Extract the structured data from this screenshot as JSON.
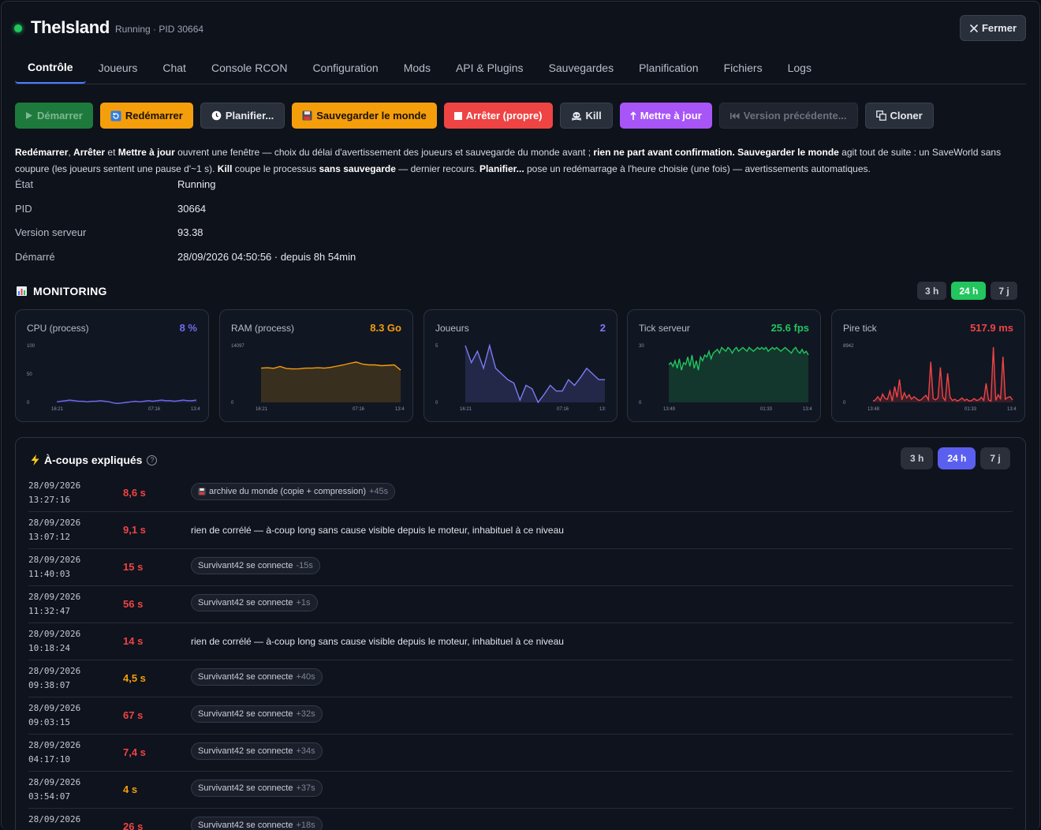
{
  "header": {
    "title": "TheIsland",
    "subtitle": "Running · PID 30664",
    "close_label": "Fermer"
  },
  "tabs": [
    "Contrôle",
    "Joueurs",
    "Chat",
    "Console RCON",
    "Configuration",
    "Mods",
    "API & Plugins",
    "Sauvegardes",
    "Planification",
    "Fichiers",
    "Logs"
  ],
  "actions": {
    "start": "Démarrer",
    "restart": "Redémarrer",
    "schedule": "Planifier...",
    "save": "Sauvegarder le monde",
    "stop": "Arrêter (propre)",
    "kill": "Kill",
    "update": "Mettre à jour",
    "rollback": "Version précédente...",
    "clone": "Cloner"
  },
  "note": {
    "p1": "Redémarrer",
    "p2": ", ",
    "p3": "Arrêter",
    "p4": " et ",
    "p5": "Mettre à jour",
    "p6": " ouvrent une fenêtre — choix du délai d'avertissement des joueurs et sauvegarde du monde avant ; ",
    "p7": "rien ne part avant confirmation.",
    "p8": " ",
    "p9": "Sauvegarder le monde",
    "p10": " agit tout de suite : un SaveWorld sans coupure (les joueurs sentent une pause d'~1 s). ",
    "p11": "Kill",
    "p12": " coupe le processus ",
    "p13": "sans sauvegarde",
    "p14": " — dernier recours. ",
    "p15": "Planifier...",
    "p16": " pose un redémarrage à l'heure choisie (une fois) — avertissements automatiques."
  },
  "info": [
    {
      "label": "État",
      "value": "Running"
    },
    {
      "label": "PID",
      "value": "30664"
    },
    {
      "label": "Version serveur",
      "value": "93.38"
    },
    {
      "label": "Démarré",
      "value": "28/09/2026 04:50:56 · depuis 8h 54min"
    }
  ],
  "monitoring": {
    "title": "MONITORING",
    "icon": "bar-chart-icon",
    "ranges": [
      "3 h",
      "24 h",
      "7 j"
    ],
    "active_range": "24 h"
  },
  "colors": {
    "cpu": "#6f6cf0",
    "ram": "#f59e0b",
    "players": "#7b7cf5",
    "tick": "#22c55e",
    "worst": "#ef4444",
    "accent_blue": "#4c7dff"
  },
  "chart_data": [
    {
      "type": "area",
      "title": "CPU (process)",
      "value": "8 %",
      "yticks": [
        "100",
        "50",
        "0"
      ],
      "xticks": [
        "16:21",
        "07:16",
        "13:4"
      ],
      "ylim": [
        0,
        100
      ],
      "values": [
        1,
        2,
        3,
        4,
        3,
        2,
        2,
        1,
        2,
        2,
        3,
        2,
        1,
        -1,
        -2,
        -1,
        0,
        1,
        2,
        1,
        2,
        3,
        2,
        3,
        4,
        3,
        3,
        2,
        3,
        4,
        3,
        3,
        4
      ]
    },
    {
      "type": "area",
      "title": "RAM (process)",
      "value": "8.3 Go",
      "yticks": [
        "14097",
        "0"
      ],
      "xticks": [
        "16:21",
        "07:16",
        "13:4"
      ],
      "ylim": [
        0,
        14097
      ],
      "values": [
        8500,
        8600,
        8450,
        8900,
        8400,
        8300,
        8350,
        8500,
        8500,
        8600,
        8500,
        8700,
        9000,
        9300,
        9700,
        10000,
        9500,
        9300,
        9300,
        9100,
        9200,
        9300,
        8000
      ]
    },
    {
      "type": "area",
      "title": "Joueurs",
      "value": "2",
      "yticks": [
        "5",
        "0"
      ],
      "xticks": [
        "16:21",
        "07:16",
        "13:"
      ],
      "ylim": [
        0,
        5
      ],
      "values": [
        5,
        3.5,
        4.5,
        3,
        5,
        3,
        2.5,
        2,
        1.7,
        0.2,
        1.5,
        1.2,
        0,
        0.7,
        1.5,
        1,
        1,
        2,
        1.5,
        2.2,
        3,
        2.5,
        2,
        2
      ]
    },
    {
      "type": "area",
      "title": "Tick serveur",
      "value": "25.6 fps",
      "yticks": [
        "30",
        "0"
      ],
      "xticks": [
        "13:49",
        "01:33",
        "13:4"
      ],
      "ylim": [
        0,
        30
      ],
      "values": [
        20,
        21,
        19,
        22,
        18,
        23,
        17,
        21,
        20,
        24,
        19,
        25,
        18,
        22,
        17,
        24,
        22,
        25,
        24,
        27,
        23,
        26,
        27,
        28,
        26,
        29,
        28,
        27,
        29,
        28,
        26,
        28,
        29,
        27,
        28,
        29,
        28,
        27,
        29,
        28,
        27,
        28,
        29,
        28,
        29,
        28,
        29,
        27,
        28,
        29,
        28,
        29,
        28,
        27,
        28,
        29,
        28,
        27,
        26,
        28,
        29,
        27,
        26,
        28,
        26,
        27,
        25
      ]
    },
    {
      "type": "area",
      "title": "Pire tick",
      "value": "517.9 ms",
      "yticks": [
        "8942",
        "0"
      ],
      "xticks": [
        "13:48",
        "01:33",
        "13:4"
      ],
      "ylim": [
        0,
        8942
      ],
      "values": [
        200,
        400,
        900,
        300,
        1300,
        600,
        500,
        1800,
        200,
        2500,
        800,
        3600,
        400,
        1500,
        700,
        1200,
        500,
        900,
        600,
        300,
        400,
        800,
        1100,
        400,
        6400,
        600,
        400,
        700,
        5500,
        800,
        300,
        4600,
        800,
        300,
        500,
        200,
        400,
        700,
        300,
        500,
        200,
        300,
        600,
        300,
        400,
        800,
        300,
        3000,
        400,
        200,
        8700,
        300,
        1200,
        600,
        7200,
        500,
        800,
        900,
        400
      ]
    }
  ],
  "jolts": {
    "title": "À-coups expliqués",
    "help": "?",
    "ranges": [
      "3 h",
      "24 h",
      "7 j"
    ],
    "active_range": "24 h",
    "rows": [
      {
        "date": "28/09/2026",
        "time": "13:27:16",
        "duration": "8,6 s",
        "level": "red",
        "kind": "chip",
        "chip_icon": "💾",
        "cause": "archive du monde (copie + compression)",
        "offset": "+45s"
      },
      {
        "date": "28/09/2026",
        "time": "13:07:12",
        "duration": "9,1 s",
        "level": "red",
        "kind": "text",
        "cause": "rien de corrélé — à-coup long sans cause visible depuis le moteur, inhabituel à ce niveau"
      },
      {
        "date": "28/09/2026",
        "time": "11:40:03",
        "duration": "15 s",
        "level": "red",
        "kind": "chip",
        "cause": "Survivant42 se connecte",
        "offset": "-15s"
      },
      {
        "date": "28/09/2026",
        "time": "11:32:47",
        "duration": "56 s",
        "level": "red",
        "kind": "chip",
        "cause": "Survivant42 se connecte",
        "offset": "+1s"
      },
      {
        "date": "28/09/2026",
        "time": "10:18:24",
        "duration": "14 s",
        "level": "red",
        "kind": "text",
        "cause": "rien de corrélé — à-coup long sans cause visible depuis le moteur, inhabituel à ce niveau"
      },
      {
        "date": "28/09/2026",
        "time": "09:38:07",
        "duration": "4,5 s",
        "level": "orange",
        "kind": "chip",
        "cause": "Survivant42 se connecte",
        "offset": "+40s"
      },
      {
        "date": "28/09/2026",
        "time": "09:03:15",
        "duration": "67 s",
        "level": "red",
        "kind": "chip",
        "cause": "Survivant42 se connecte",
        "offset": "+32s"
      },
      {
        "date": "28/09/2026",
        "time": "04:17:10",
        "duration": "7,4 s",
        "level": "red",
        "kind": "chip",
        "cause": "Survivant42 se connecte",
        "offset": "+34s"
      },
      {
        "date": "28/09/2026",
        "time": "03:54:07",
        "duration": "4 s",
        "level": "orange",
        "kind": "chip",
        "cause": "Survivant42 se connecte",
        "offset": "+37s"
      },
      {
        "date": "28/09/2026",
        "time": "",
        "duration": "26 s",
        "level": "red",
        "kind": "chip",
        "cause": "Survivant42 se connecte",
        "offset": "+18s"
      }
    ]
  }
}
